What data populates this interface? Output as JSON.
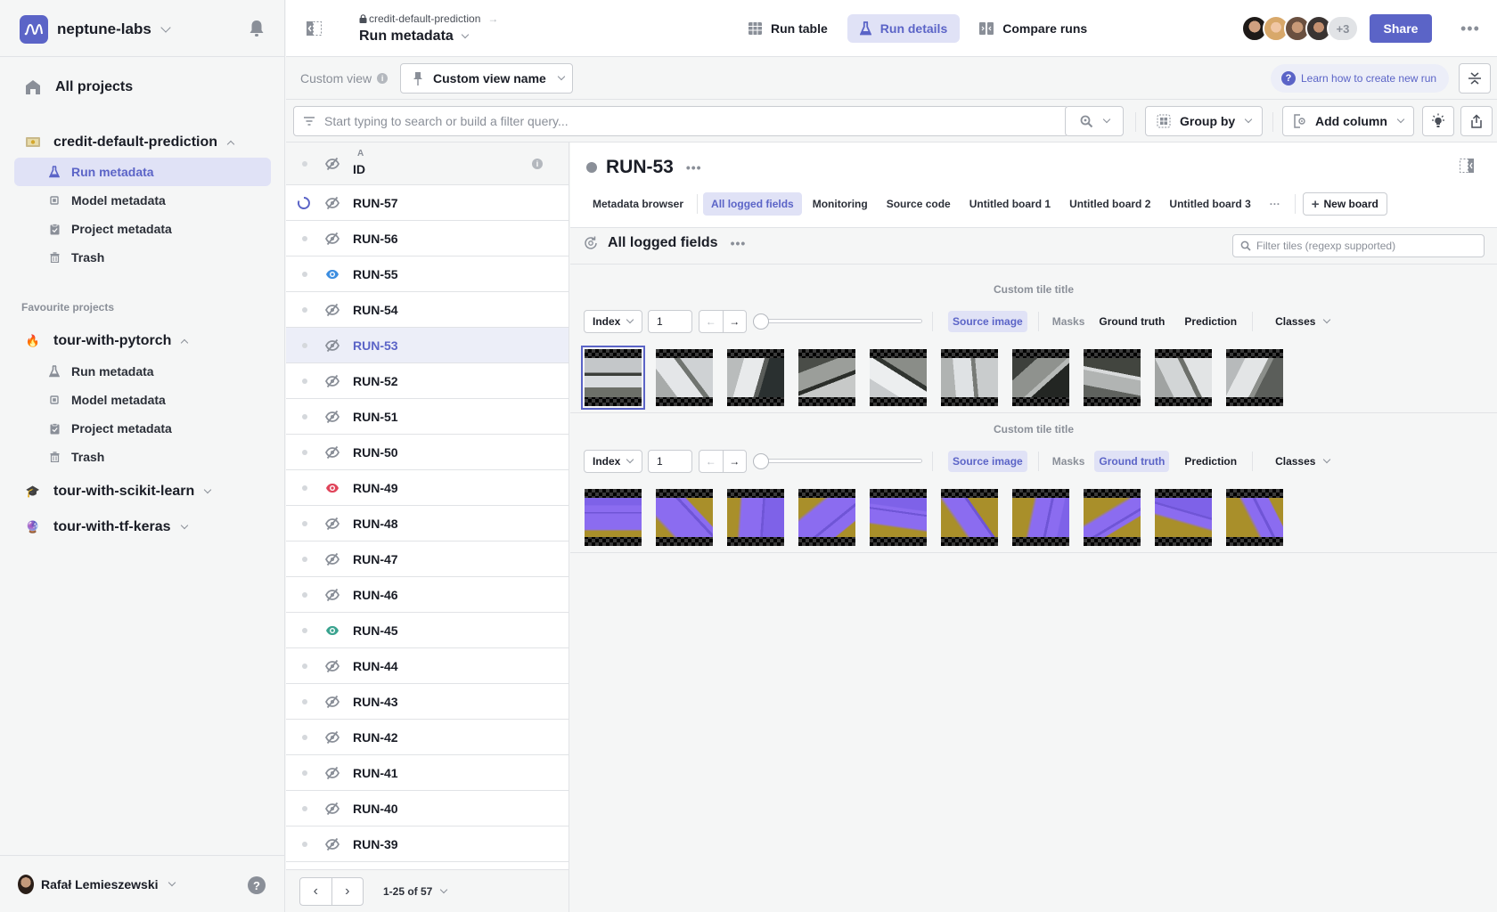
{
  "sidebar": {
    "org_name": "neptune-labs",
    "all_projects": "All projects",
    "current_project": {
      "name": "credit-default-prediction",
      "icon": "money-emoji",
      "items": [
        {
          "label": "Run metadata",
          "icon": "flask-icon",
          "active": true
        },
        {
          "label": "Model metadata",
          "icon": "chip-icon",
          "active": false
        },
        {
          "label": "Project metadata",
          "icon": "clipboard-icon",
          "active": false
        },
        {
          "label": "Trash",
          "icon": "trash-icon",
          "active": false
        }
      ]
    },
    "favourites_label": "Favourite projects",
    "favourites": [
      {
        "name": "tour-with-pytorch",
        "icon": "🔥",
        "expanded": true,
        "items": [
          {
            "label": "Run metadata",
            "icon": "flask-icon"
          },
          {
            "label": "Model metadata",
            "icon": "chip-icon"
          },
          {
            "label": "Project metadata",
            "icon": "clipboard-icon"
          },
          {
            "label": "Trash",
            "icon": "trash-icon"
          }
        ]
      },
      {
        "name": "tour-with-scikit-learn",
        "icon": "🎓",
        "expanded": false
      },
      {
        "name": "tour-with-tf-keras",
        "icon": "🔮",
        "expanded": false
      }
    ],
    "user_name": "Rafał Lemieszewski",
    "help_label": "?"
  },
  "topbar": {
    "breadcrumb": "credit-default-prediction",
    "title": "Run metadata",
    "tabs": [
      {
        "label": "Run table",
        "icon": "table-icon",
        "active": false
      },
      {
        "label": "Run details",
        "icon": "flask-icon",
        "active": true
      },
      {
        "label": "Compare runs",
        "icon": "compare-icon",
        "active": false
      }
    ],
    "extra_members": "+3",
    "share_label": "Share",
    "more_label": "•••"
  },
  "viewbar": {
    "custom_view_label": "Custom view",
    "custom_view_name": "Custom view name",
    "learn_label": "Learn how to create new run"
  },
  "filterbar": {
    "search_placeholder": "Start typing to search or build a filter query...",
    "group_by_label": "Group by",
    "add_column_label": "Add column"
  },
  "table": {
    "column_sort_label": "A",
    "column_header": "ID",
    "rows": [
      {
        "id": "RUN-57",
        "status": "running",
        "eye": "hidden"
      },
      {
        "id": "RUN-56",
        "status": "idle",
        "eye": "hidden"
      },
      {
        "id": "RUN-55",
        "status": "idle",
        "eye": "visible-blue"
      },
      {
        "id": "RUN-54",
        "status": "idle",
        "eye": "hidden"
      },
      {
        "id": "RUN-53",
        "status": "idle",
        "eye": "hidden",
        "selected": true
      },
      {
        "id": "RUN-52",
        "status": "idle",
        "eye": "hidden"
      },
      {
        "id": "RUN-51",
        "status": "idle",
        "eye": "hidden"
      },
      {
        "id": "RUN-50",
        "status": "idle",
        "eye": "hidden"
      },
      {
        "id": "RUN-49",
        "status": "idle",
        "eye": "visible-red"
      },
      {
        "id": "RUN-48",
        "status": "idle",
        "eye": "hidden"
      },
      {
        "id": "RUN-47",
        "status": "idle",
        "eye": "hidden"
      },
      {
        "id": "RUN-46",
        "status": "idle",
        "eye": "hidden"
      },
      {
        "id": "RUN-45",
        "status": "idle",
        "eye": "visible-teal"
      },
      {
        "id": "RUN-44",
        "status": "idle",
        "eye": "hidden"
      },
      {
        "id": "RUN-43",
        "status": "idle",
        "eye": "hidden"
      },
      {
        "id": "RUN-42",
        "status": "idle",
        "eye": "hidden"
      },
      {
        "id": "RUN-41",
        "status": "idle",
        "eye": "hidden"
      },
      {
        "id": "RUN-40",
        "status": "idle",
        "eye": "hidden"
      },
      {
        "id": "RUN-39",
        "status": "idle",
        "eye": "hidden"
      }
    ],
    "pagination": "1-25 of 57"
  },
  "details": {
    "run_id": "RUN-53",
    "board_tabs": [
      {
        "label": "Metadata browser",
        "active": false
      },
      {
        "label": "All logged fields",
        "active": true
      },
      {
        "label": "Monitoring",
        "active": false
      },
      {
        "label": "Source code",
        "active": false
      },
      {
        "label": "Untitled board 1",
        "active": false
      },
      {
        "label": "Untitled board 2",
        "active": false
      },
      {
        "label": "Untitled board 3",
        "active": false
      }
    ],
    "more_tabs": "···",
    "new_board_label": "New board",
    "section_title": "All logged fields",
    "tile_filter_placeholder": "Filter tiles (regexp supported)",
    "tiles": [
      {
        "title": "Custom tile title",
        "index_label": "Index",
        "index_value": "1",
        "slider_position": 0,
        "source_image_label": "Source image",
        "masks_label": "Masks",
        "ground_truth_label": "Ground truth",
        "prediction_label": "Prediction",
        "classes_label": "Classes",
        "ground_truth_active": false,
        "mask_overlay": false,
        "images": 10,
        "selected_image": 0
      },
      {
        "title": "Custom tile title",
        "index_label": "Index",
        "index_value": "1",
        "slider_position": 0,
        "source_image_label": "Source image",
        "masks_label": "Masks",
        "ground_truth_label": "Ground truth",
        "prediction_label": "Prediction",
        "classes_label": "Classes",
        "ground_truth_active": true,
        "mask_overlay": true,
        "images": 10,
        "selected_image": -1
      }
    ]
  },
  "colors": {
    "accent": "#5b64c7",
    "accent_bg": "#e0e2f6",
    "eye_blue": "#3d8ee0",
    "eye_red": "#e0445a",
    "eye_teal": "#3aa38f",
    "mask_purple": "#8b6cf0",
    "mask_yellow": "#a98f2a"
  }
}
